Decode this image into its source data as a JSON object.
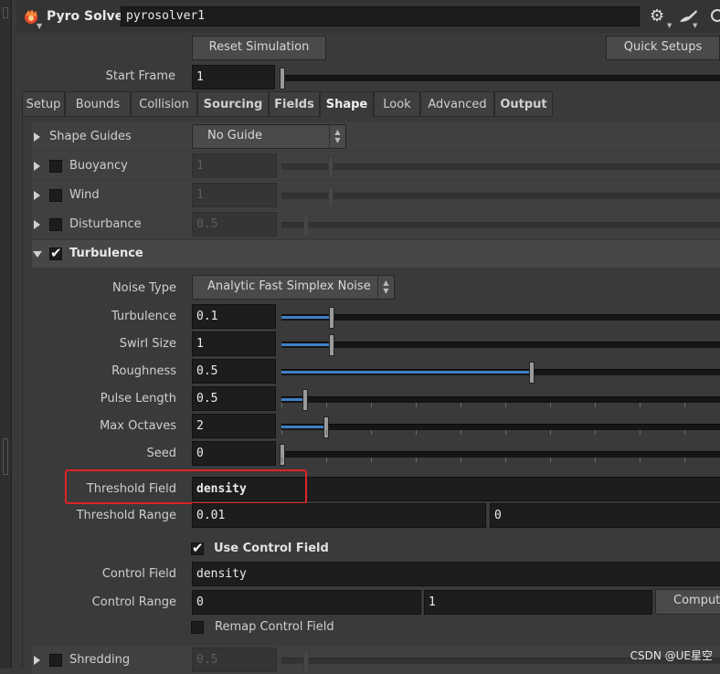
{
  "header": {
    "node_type": "Pyro Solver",
    "node_name": "pyrosolver1"
  },
  "buttons": {
    "reset_simulation": "Reset Simulation",
    "quick_setups": "Quick Setups"
  },
  "start_frame": {
    "label": "Start Frame",
    "value": "1"
  },
  "tabs": [
    "Setup",
    "Bounds",
    "Collision",
    "Sourcing",
    "Fields",
    "Shape",
    "Look",
    "Advanced",
    "Output"
  ],
  "active_tab": "Shape",
  "shape_guides": {
    "label": "Shape Guides",
    "value": "No Guide"
  },
  "collapsed_folders": [
    {
      "label": "Buoyancy",
      "value": "1"
    },
    {
      "label": "Wind",
      "value": "1"
    },
    {
      "label": "Disturbance",
      "value": "0.5"
    }
  ],
  "turbulence_folder": {
    "label": "Turbulence",
    "noise_type": {
      "label": "Noise Type",
      "value": "Analytic Fast Simplex Noise"
    },
    "params": [
      {
        "label": "Turbulence",
        "value": "0.1",
        "level": 0.116
      },
      {
        "label": "Swirl Size",
        "value": "1",
        "level": 0.116
      },
      {
        "label": "Roughness",
        "value": "0.5",
        "level": 0.573
      },
      {
        "label": "Pulse Length",
        "value": "0.5",
        "level": 0.056
      },
      {
        "label": "Max Octaves",
        "value": "2",
        "level": 0.104
      },
      {
        "label": "Seed",
        "value": "0",
        "level": 0.0
      }
    ],
    "threshold_field": {
      "label": "Threshold Field",
      "value": "density"
    },
    "threshold_range": {
      "label": "Threshold Range",
      "min": "0.01",
      "max": "0"
    },
    "use_control_field": {
      "label": "Use Control Field",
      "checked": true
    },
    "control_field": {
      "label": "Control Field",
      "value": "density"
    },
    "control_range": {
      "label": "Control Range",
      "min": "0",
      "max": "1",
      "compute_label": "Compute"
    },
    "remap_control_field": {
      "label": "Remap Control Field",
      "checked": false
    }
  },
  "shredding": {
    "label": "Shredding",
    "value": "0.5"
  },
  "watermark": "CSDN @UE星空",
  "colors": {
    "slider_fill": "#3f7fc6",
    "highlight_box": "#e02424"
  }
}
